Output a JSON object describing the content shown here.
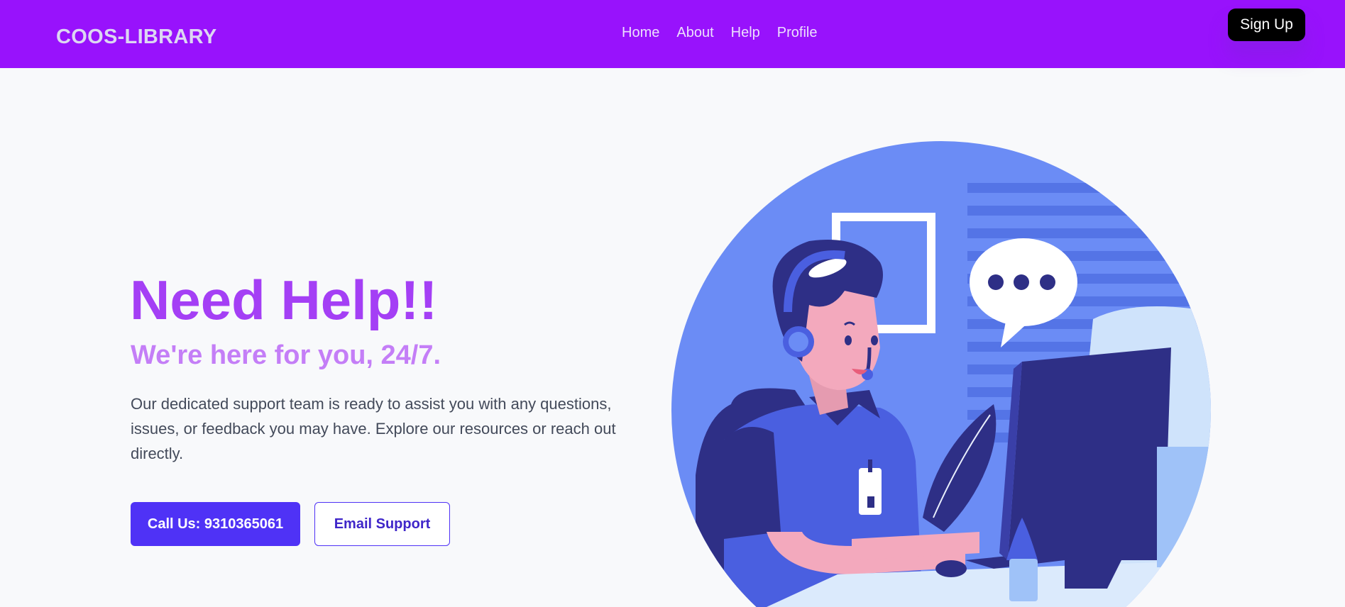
{
  "nav": {
    "brand": "COOS-LIBRARY",
    "links": [
      {
        "label": "Home"
      },
      {
        "label": "About"
      },
      {
        "label": "Help"
      },
      {
        "label": "Profile"
      }
    ],
    "signup_label": "Sign Up"
  },
  "hero": {
    "title": "Need Help!!",
    "subtitle": "We're here for you, 24/7.",
    "description": "Our dedicated support team is ready to assist you with any questions, issues, or feedback you may have. Explore our resources or reach out directly.",
    "call_label": "Call Us: 9310365061",
    "email_label": "Email Support"
  },
  "colors": {
    "nav_bg": "#9812fc",
    "title": "#a43ff5",
    "subtitle": "#c47ef7",
    "primary_button": "#4f32f6",
    "illustration_bg": "#6b8cf5"
  },
  "illustration": {
    "icon": "customer-support-agent-illustration"
  }
}
